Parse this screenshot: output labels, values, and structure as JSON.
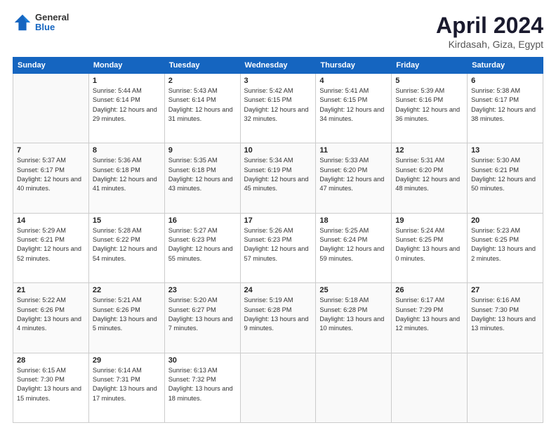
{
  "header": {
    "logo_general": "General",
    "logo_blue": "Blue",
    "month_title": "April 2024",
    "subtitle": "Kirdasah, Giza, Egypt"
  },
  "weekdays": [
    "Sunday",
    "Monday",
    "Tuesday",
    "Wednesday",
    "Thursday",
    "Friday",
    "Saturday"
  ],
  "weeks": [
    [
      {
        "day": "",
        "sunrise": "",
        "sunset": "",
        "daylight": ""
      },
      {
        "day": "1",
        "sunrise": "Sunrise: 5:44 AM",
        "sunset": "Sunset: 6:14 PM",
        "daylight": "Daylight: 12 hours and 29 minutes."
      },
      {
        "day": "2",
        "sunrise": "Sunrise: 5:43 AM",
        "sunset": "Sunset: 6:14 PM",
        "daylight": "Daylight: 12 hours and 31 minutes."
      },
      {
        "day": "3",
        "sunrise": "Sunrise: 5:42 AM",
        "sunset": "Sunset: 6:15 PM",
        "daylight": "Daylight: 12 hours and 32 minutes."
      },
      {
        "day": "4",
        "sunrise": "Sunrise: 5:41 AM",
        "sunset": "Sunset: 6:15 PM",
        "daylight": "Daylight: 12 hours and 34 minutes."
      },
      {
        "day": "5",
        "sunrise": "Sunrise: 5:39 AM",
        "sunset": "Sunset: 6:16 PM",
        "daylight": "Daylight: 12 hours and 36 minutes."
      },
      {
        "day": "6",
        "sunrise": "Sunrise: 5:38 AM",
        "sunset": "Sunset: 6:17 PM",
        "daylight": "Daylight: 12 hours and 38 minutes."
      }
    ],
    [
      {
        "day": "7",
        "sunrise": "Sunrise: 5:37 AM",
        "sunset": "Sunset: 6:17 PM",
        "daylight": "Daylight: 12 hours and 40 minutes."
      },
      {
        "day": "8",
        "sunrise": "Sunrise: 5:36 AM",
        "sunset": "Sunset: 6:18 PM",
        "daylight": "Daylight: 12 hours and 41 minutes."
      },
      {
        "day": "9",
        "sunrise": "Sunrise: 5:35 AM",
        "sunset": "Sunset: 6:18 PM",
        "daylight": "Daylight: 12 hours and 43 minutes."
      },
      {
        "day": "10",
        "sunrise": "Sunrise: 5:34 AM",
        "sunset": "Sunset: 6:19 PM",
        "daylight": "Daylight: 12 hours and 45 minutes."
      },
      {
        "day": "11",
        "sunrise": "Sunrise: 5:33 AM",
        "sunset": "Sunset: 6:20 PM",
        "daylight": "Daylight: 12 hours and 47 minutes."
      },
      {
        "day": "12",
        "sunrise": "Sunrise: 5:31 AM",
        "sunset": "Sunset: 6:20 PM",
        "daylight": "Daylight: 12 hours and 48 minutes."
      },
      {
        "day": "13",
        "sunrise": "Sunrise: 5:30 AM",
        "sunset": "Sunset: 6:21 PM",
        "daylight": "Daylight: 12 hours and 50 minutes."
      }
    ],
    [
      {
        "day": "14",
        "sunrise": "Sunrise: 5:29 AM",
        "sunset": "Sunset: 6:21 PM",
        "daylight": "Daylight: 12 hours and 52 minutes."
      },
      {
        "day": "15",
        "sunrise": "Sunrise: 5:28 AM",
        "sunset": "Sunset: 6:22 PM",
        "daylight": "Daylight: 12 hours and 54 minutes."
      },
      {
        "day": "16",
        "sunrise": "Sunrise: 5:27 AM",
        "sunset": "Sunset: 6:23 PM",
        "daylight": "Daylight: 12 hours and 55 minutes."
      },
      {
        "day": "17",
        "sunrise": "Sunrise: 5:26 AM",
        "sunset": "Sunset: 6:23 PM",
        "daylight": "Daylight: 12 hours and 57 minutes."
      },
      {
        "day": "18",
        "sunrise": "Sunrise: 5:25 AM",
        "sunset": "Sunset: 6:24 PM",
        "daylight": "Daylight: 12 hours and 59 minutes."
      },
      {
        "day": "19",
        "sunrise": "Sunrise: 5:24 AM",
        "sunset": "Sunset: 6:25 PM",
        "daylight": "Daylight: 13 hours and 0 minutes."
      },
      {
        "day": "20",
        "sunrise": "Sunrise: 5:23 AM",
        "sunset": "Sunset: 6:25 PM",
        "daylight": "Daylight: 13 hours and 2 minutes."
      }
    ],
    [
      {
        "day": "21",
        "sunrise": "Sunrise: 5:22 AM",
        "sunset": "Sunset: 6:26 PM",
        "daylight": "Daylight: 13 hours and 4 minutes."
      },
      {
        "day": "22",
        "sunrise": "Sunrise: 5:21 AM",
        "sunset": "Sunset: 6:26 PM",
        "daylight": "Daylight: 13 hours and 5 minutes."
      },
      {
        "day": "23",
        "sunrise": "Sunrise: 5:20 AM",
        "sunset": "Sunset: 6:27 PM",
        "daylight": "Daylight: 13 hours and 7 minutes."
      },
      {
        "day": "24",
        "sunrise": "Sunrise: 5:19 AM",
        "sunset": "Sunset: 6:28 PM",
        "daylight": "Daylight: 13 hours and 9 minutes."
      },
      {
        "day": "25",
        "sunrise": "Sunrise: 5:18 AM",
        "sunset": "Sunset: 6:28 PM",
        "daylight": "Daylight: 13 hours and 10 minutes."
      },
      {
        "day": "26",
        "sunrise": "Sunrise: 6:17 AM",
        "sunset": "Sunset: 7:29 PM",
        "daylight": "Daylight: 13 hours and 12 minutes."
      },
      {
        "day": "27",
        "sunrise": "Sunrise: 6:16 AM",
        "sunset": "Sunset: 7:30 PM",
        "daylight": "Daylight: 13 hours and 13 minutes."
      }
    ],
    [
      {
        "day": "28",
        "sunrise": "Sunrise: 6:15 AM",
        "sunset": "Sunset: 7:30 PM",
        "daylight": "Daylight: 13 hours and 15 minutes."
      },
      {
        "day": "29",
        "sunrise": "Sunrise: 6:14 AM",
        "sunset": "Sunset: 7:31 PM",
        "daylight": "Daylight: 13 hours and 17 minutes."
      },
      {
        "day": "30",
        "sunrise": "Sunrise: 6:13 AM",
        "sunset": "Sunset: 7:32 PM",
        "daylight": "Daylight: 13 hours and 18 minutes."
      },
      {
        "day": "",
        "sunrise": "",
        "sunset": "",
        "daylight": ""
      },
      {
        "day": "",
        "sunrise": "",
        "sunset": "",
        "daylight": ""
      },
      {
        "day": "",
        "sunrise": "",
        "sunset": "",
        "daylight": ""
      },
      {
        "day": "",
        "sunrise": "",
        "sunset": "",
        "daylight": ""
      }
    ]
  ]
}
